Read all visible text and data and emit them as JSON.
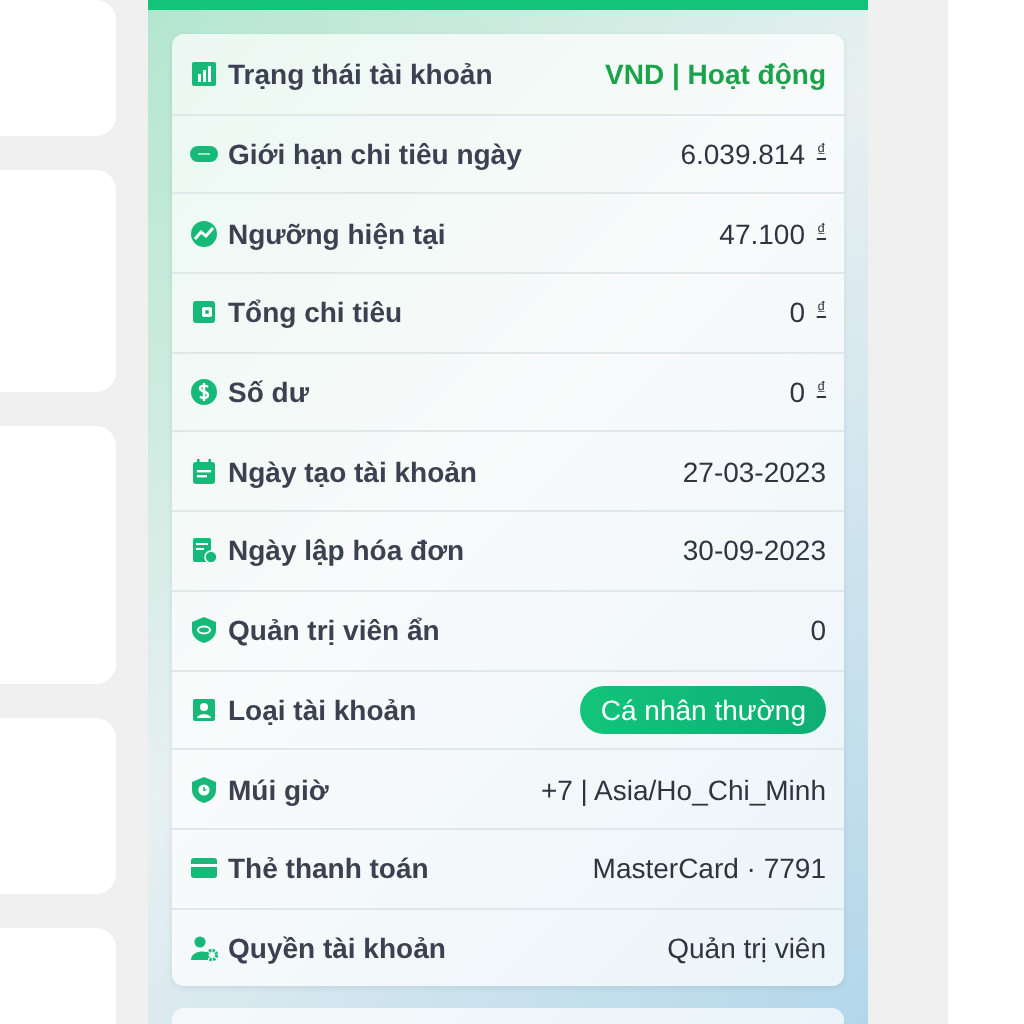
{
  "account_details": [
    {
      "label": "Trạng thái tài khoản",
      "value": "VND | Hoạt động",
      "kind": "status"
    },
    {
      "label": "Giới hạn chi tiêu ngày",
      "value": "6.039.814 $^{₫}$",
      "kind": "text"
    },
    {
      "label": "Ngưỡng hiện tại",
      "value": "47.100 $^{₫}$",
      "kind": "text"
    },
    {
      "label": "Tổng chi tiêu",
      "value": "0 $^{₫}$",
      "kind": "text"
    },
    {
      "label": "Số dư",
      "value": "0 $^{₫}$",
      "kind": "text"
    },
    {
      "label": "Ngày tạo tài khoản",
      "value": "27-03-2023",
      "kind": "text"
    },
    {
      "label": "Ngày lập hóa đơn",
      "value": "30-09-2023",
      "kind": "text"
    },
    {
      "label": "Quản trị viên ẩn",
      "value": "0",
      "kind": "text"
    },
    {
      "label": "Loại tài khoản",
      "value": "Cá nhân thường",
      "kind": "badge"
    },
    {
      "label": "Múi giờ",
      "value": "+7 | Asia/Ho_Chi_Minh",
      "kind": "text"
    },
    {
      "label": "Thẻ thanh toán",
      "value": "MasterCard · 7791",
      "kind": "text"
    },
    {
      "label": "Quyền tài khoản",
      "value": "Quản trị viên",
      "kind": "text"
    }
  ]
}
